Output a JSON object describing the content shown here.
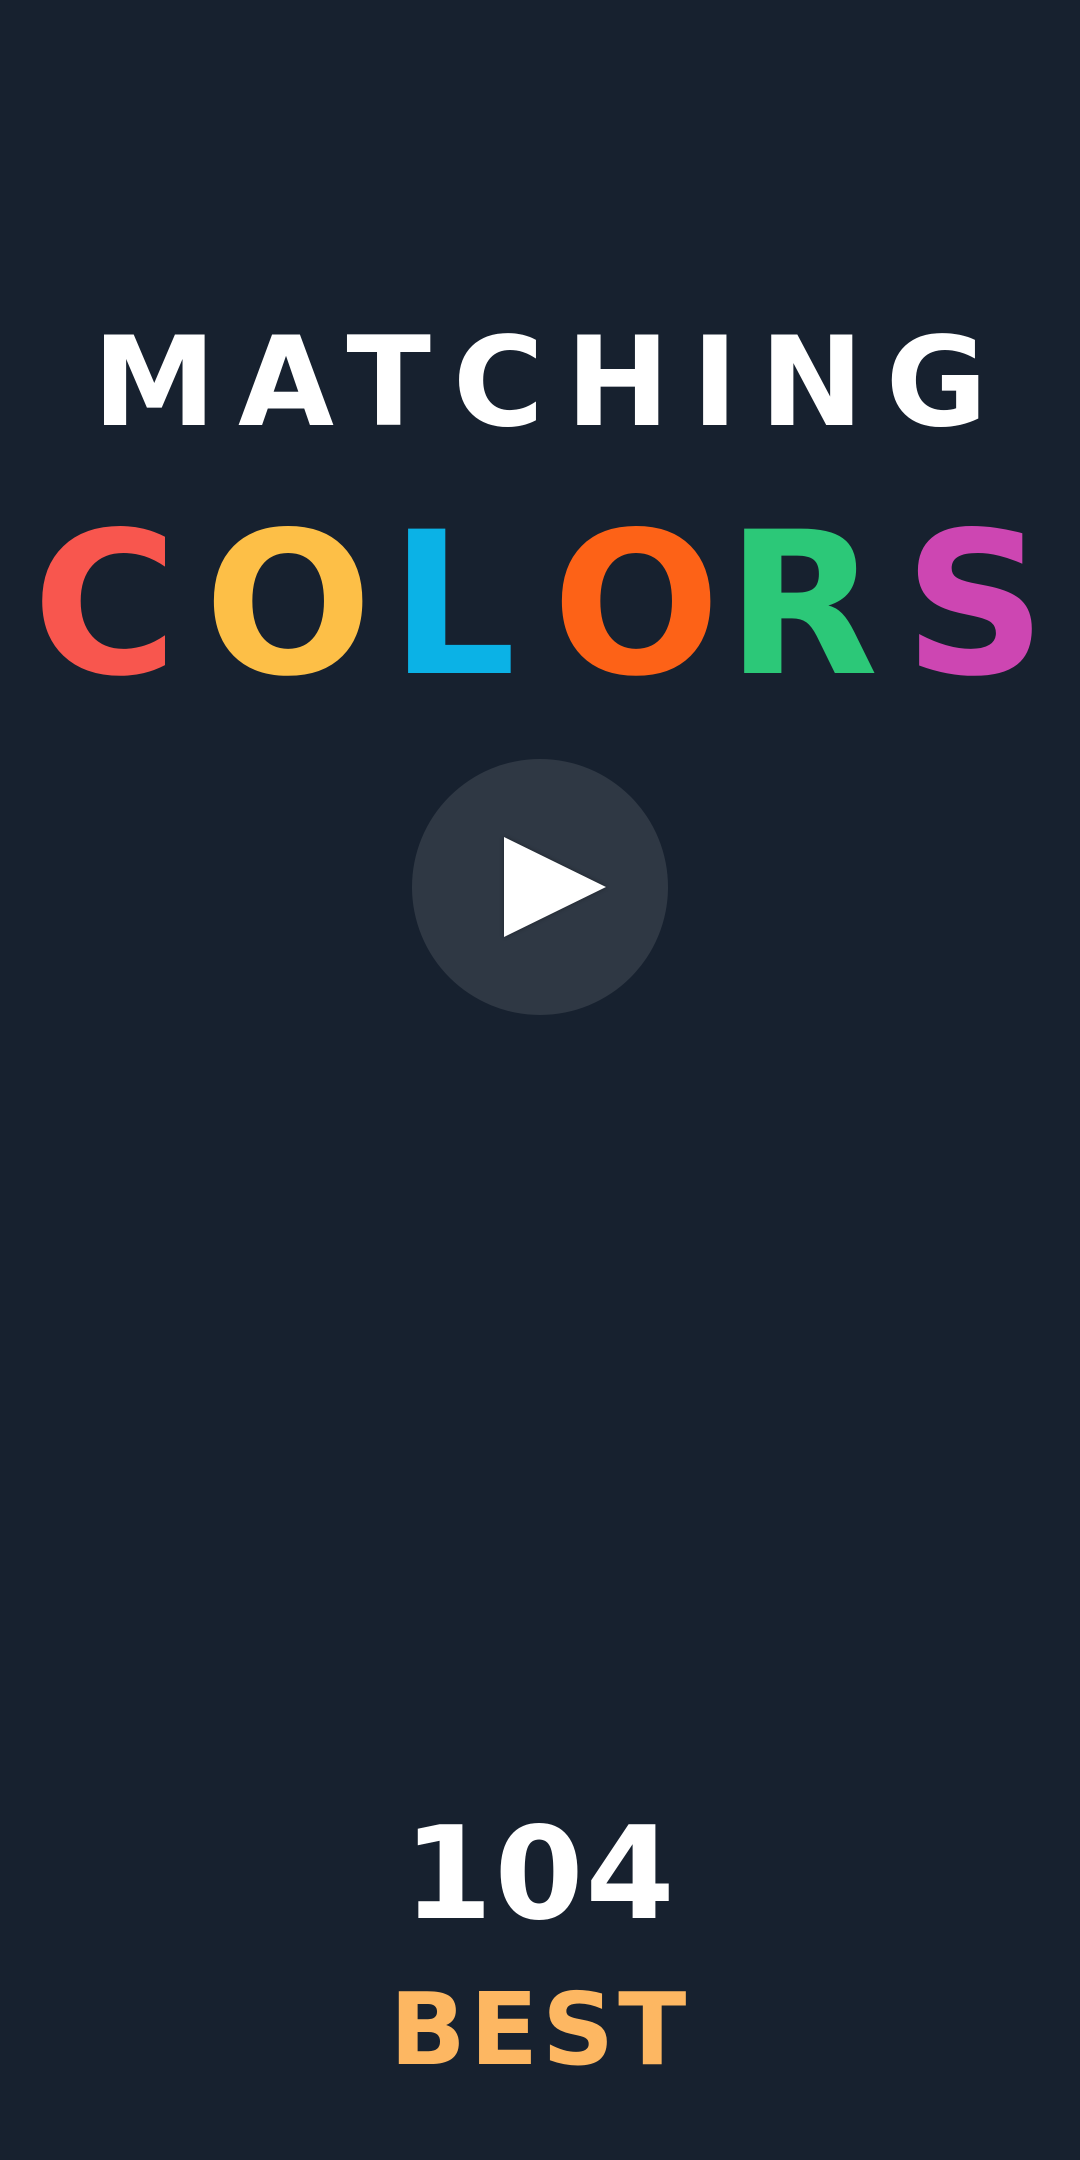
{
  "title": {
    "line1": "MATCHING",
    "line2_letters": [
      {
        "char": "C",
        "color": "#f8564e"
      },
      {
        "char": "O",
        "color": "#fdbf47"
      },
      {
        "char": "L",
        "color": "#0bb2e6"
      },
      {
        "char": "O",
        "color": "#fd6217"
      },
      {
        "char": "R",
        "color": "#2cc878"
      },
      {
        "char": "S",
        "color": "#cd46b2"
      }
    ]
  },
  "play_button": {
    "icon": "play-icon"
  },
  "score": {
    "value": "104"
  },
  "best": {
    "label": "BEST",
    "color": "#fdb762"
  },
  "colors": {
    "background": "#17212f",
    "button_bg": "#2f3844",
    "text": "#ffffff"
  }
}
